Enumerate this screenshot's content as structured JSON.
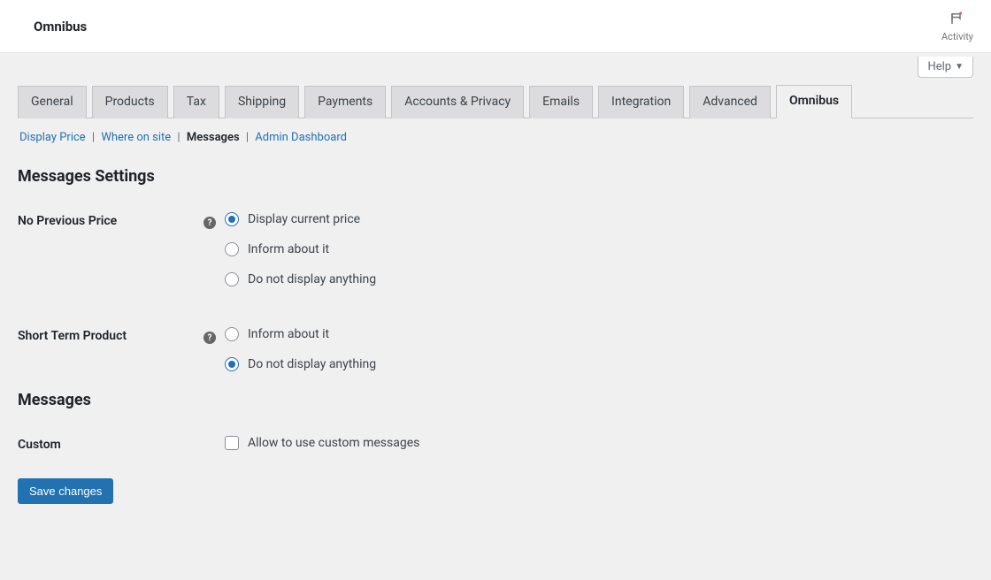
{
  "topbar": {
    "title": "Omnibus",
    "activity_label": "Activity"
  },
  "help_button": "Help",
  "tabs": [
    {
      "label": "General"
    },
    {
      "label": "Products"
    },
    {
      "label": "Tax"
    },
    {
      "label": "Shipping"
    },
    {
      "label": "Payments"
    },
    {
      "label": "Accounts & Privacy"
    },
    {
      "label": "Emails"
    },
    {
      "label": "Integration"
    },
    {
      "label": "Advanced"
    },
    {
      "label": "Omnibus",
      "active": true
    }
  ],
  "subnav": {
    "items": [
      {
        "label": "Display Price",
        "link": true
      },
      {
        "label": "Where on site",
        "link": true
      },
      {
        "label": "Messages",
        "current": true
      },
      {
        "label": "Admin Dashboard",
        "link": true
      }
    ]
  },
  "sections": {
    "messages_settings_heading": "Messages Settings",
    "messages_heading": "Messages"
  },
  "no_previous_price": {
    "label": "No Previous Price",
    "options": [
      {
        "label": "Display current price",
        "checked": true
      },
      {
        "label": "Inform about it",
        "checked": false
      },
      {
        "label": "Do not display anything",
        "checked": false
      }
    ]
  },
  "short_term_product": {
    "label": "Short Term Product",
    "options": [
      {
        "label": "Inform about it",
        "checked": false
      },
      {
        "label": "Do not display anything",
        "checked": true
      }
    ]
  },
  "custom": {
    "label": "Custom",
    "checkbox_label": "Allow to use custom messages",
    "checked": false
  },
  "save_button": "Save changes"
}
